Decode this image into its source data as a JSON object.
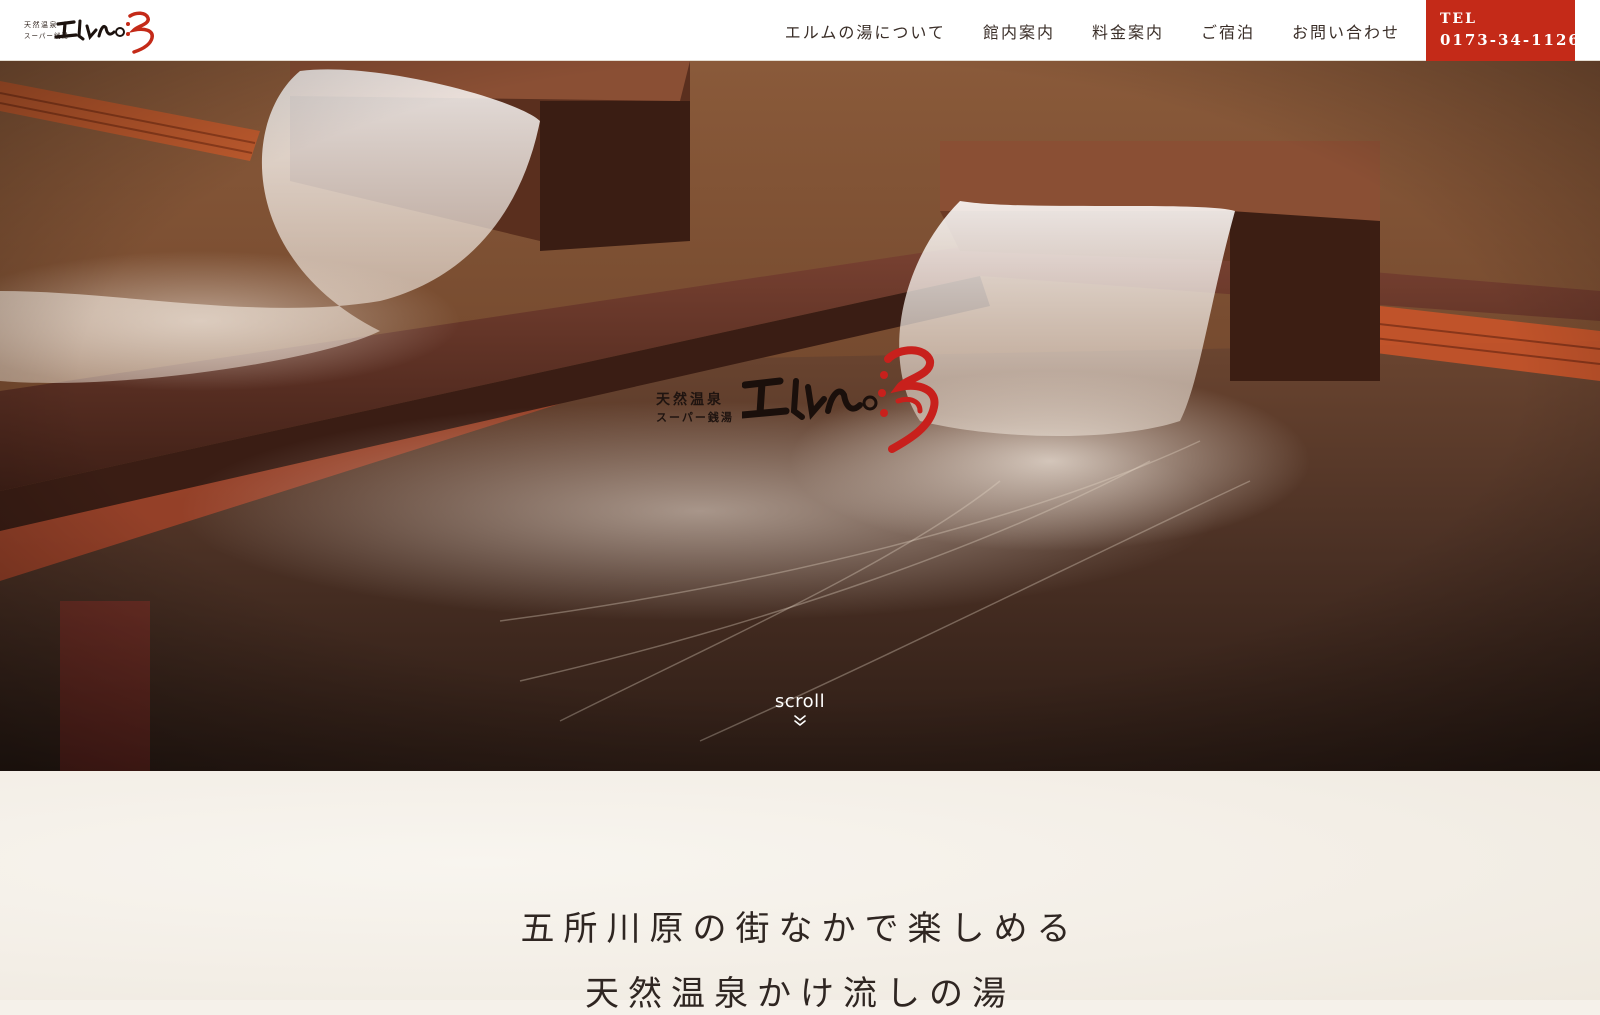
{
  "header": {
    "logo": {
      "tagline_top": "天然温泉",
      "tagline_bottom": "スーパー銭湯",
      "name": "エルムの湯"
    },
    "nav": [
      {
        "label": "エルムの湯について"
      },
      {
        "label": "館内案内"
      },
      {
        "label": "料金案内"
      },
      {
        "label": "ご宿泊"
      },
      {
        "label": "お問い合わせ"
      }
    ],
    "tel": {
      "label": "TEL",
      "number": "0173-34-1126"
    }
  },
  "hero": {
    "logo": {
      "tagline_top": "天然温泉",
      "tagline_bottom": "スーパー銭湯",
      "name": "エルムの湯"
    },
    "scroll_label": "scroll"
  },
  "intro": {
    "heading_line_1": "五所川原の街なかで楽しめる",
    "heading_line_2": "天然温泉かけ流しの湯"
  },
  "colors": {
    "accent": "#c42a18",
    "text_dark": "#3a2e28",
    "background": "#f5f1ea"
  }
}
